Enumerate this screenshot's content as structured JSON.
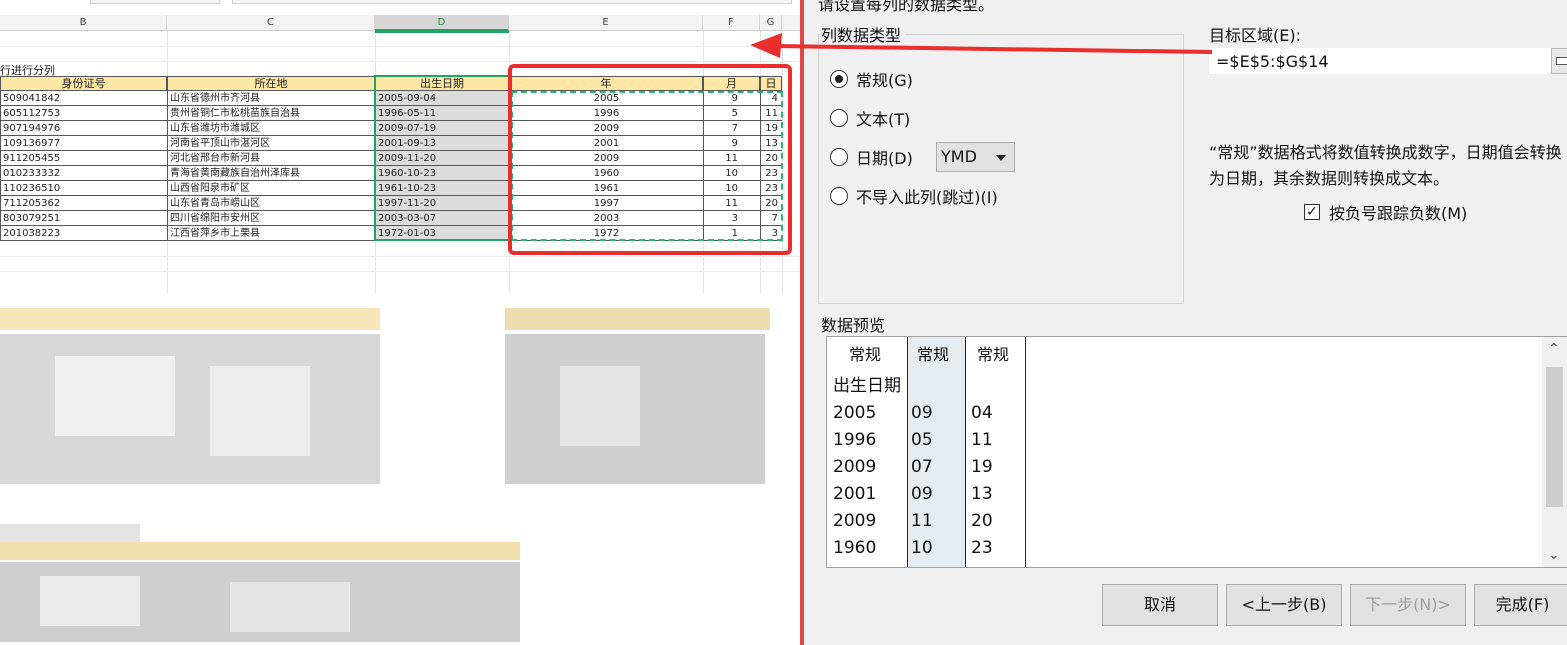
{
  "sheet": {
    "columns": [
      "B",
      "C",
      "D",
      "E",
      "F",
      "G"
    ],
    "caption": "行进行分列",
    "headers": {
      "id": "身份证号",
      "location": "所在地",
      "birthdate": "出生日期",
      "year": "年",
      "month": "月",
      "day": "日"
    },
    "rows": [
      {
        "id": "509041842",
        "location": "山东省德州市齐河县",
        "birthdate": "2005-09-04",
        "year": "2005",
        "month": "9",
        "day": "4"
      },
      {
        "id": "605112753",
        "location": "贵州省铜仁市松桃苗族自治县",
        "birthdate": "1996-05-11",
        "year": "1996",
        "month": "5",
        "day": "11"
      },
      {
        "id": "907194976",
        "location": "山东省潍坊市潍城区",
        "birthdate": "2009-07-19",
        "year": "2009",
        "month": "7",
        "day": "19"
      },
      {
        "id": "109136977",
        "location": "河南省平顶山市湛河区",
        "birthdate": "2001-09-13",
        "year": "2001",
        "month": "9",
        "day": "13"
      },
      {
        "id": "911205455",
        "location": "河北省邢台市新河县",
        "birthdate": "2009-11-20",
        "year": "2009",
        "month": "11",
        "day": "20"
      },
      {
        "id": "010233332",
        "location": "青海省黄南藏族自治州泽库县",
        "birthdate": "1960-10-23",
        "year": "1960",
        "month": "10",
        "day": "23"
      },
      {
        "id": "110236510",
        "location": "山西省阳泉市矿区",
        "birthdate": "1961-10-23",
        "year": "1961",
        "month": "10",
        "day": "23"
      },
      {
        "id": "711205362",
        "location": "山东省青岛市崂山区",
        "birthdate": "1997-11-20",
        "year": "1997",
        "month": "11",
        "day": "20"
      },
      {
        "id": "803079251",
        "location": "四川省绵阳市安州区",
        "birthdate": "2003-03-07",
        "year": "2003",
        "month": "3",
        "day": "7"
      },
      {
        "id": "201038223",
        "location": "江西省萍乡市上栗县",
        "birthdate": "1972-01-03",
        "year": "1972",
        "month": "1",
        "day": "3"
      }
    ]
  },
  "dialog": {
    "title": "请设置每列的数据类型。",
    "column_type_group": "列数据类型",
    "radio_general": "常规(G)",
    "radio_text": "文本(T)",
    "radio_date": "日期(D)",
    "radio_skip": "不导入此列(跳过)(I)",
    "selected_radio": "常规(G)",
    "date_format": "YMD",
    "target_label": "目标区域(E):",
    "target_value": "=$E$5:$G$14",
    "description": "“常规”数据格式将数值转换成数字，日期值会转换为日期，其余数据则转换成文本。",
    "checkbox_label": "按负号跟踪负数(M)",
    "checkbox_checked": true,
    "preview_label": "数据预览",
    "preview_headers": [
      "常规",
      "常规",
      "常规"
    ],
    "preview_rows": [
      [
        "出生日期",
        "",
        ""
      ],
      [
        "2005",
        "09",
        "04"
      ],
      [
        "1996",
        "05",
        "11"
      ],
      [
        "2009",
        "07",
        "19"
      ],
      [
        "2001",
        "09",
        "13"
      ],
      [
        "2009",
        "11",
        "20"
      ],
      [
        "1960",
        "10",
        "23"
      ]
    ],
    "buttons": {
      "cancel": "取消",
      "back": "<上一步(B)",
      "next": "下一步(N)>",
      "finish": "完成(F)"
    },
    "colors": {
      "red_annotation": "#ea2d2d",
      "selection_green": "#21a366",
      "header_fill": "#fde6a6"
    }
  }
}
